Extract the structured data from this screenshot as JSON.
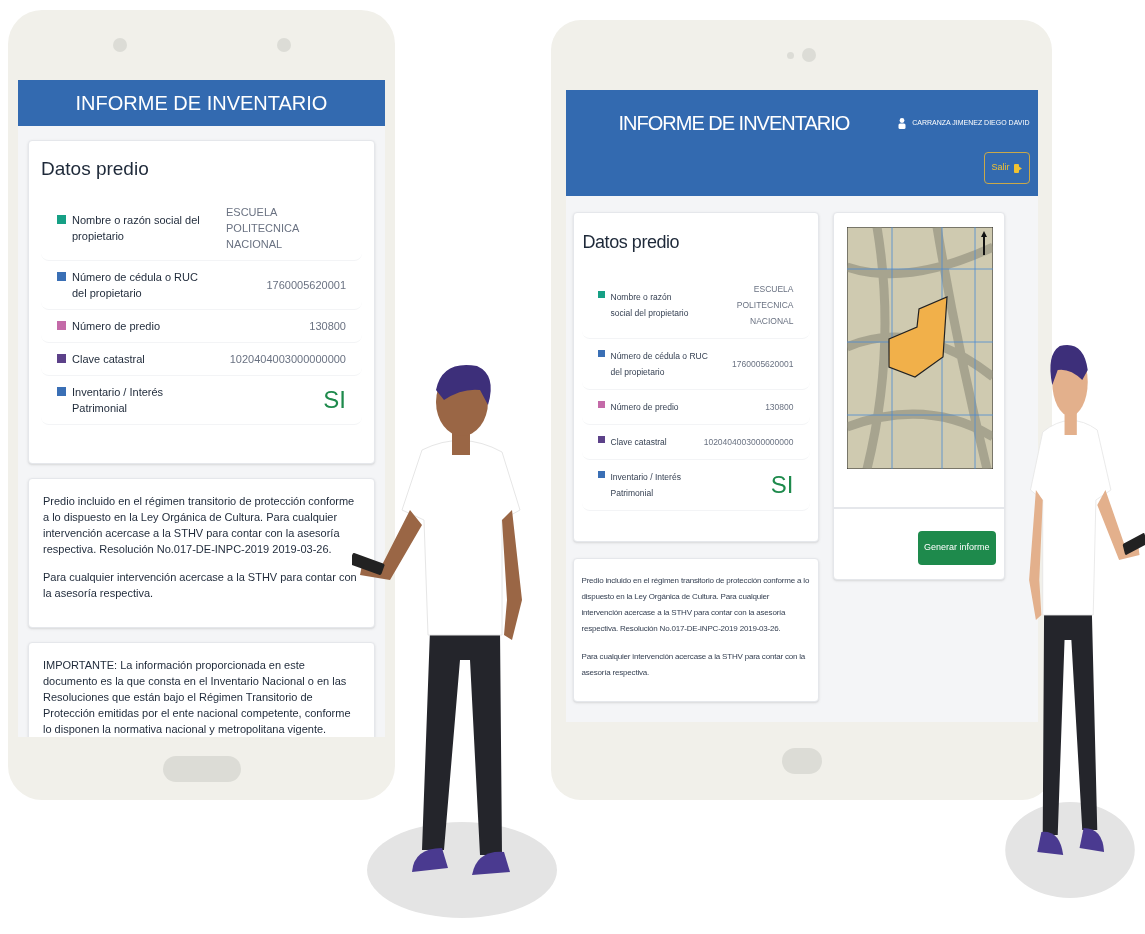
{
  "phone": {
    "header": {
      "title": "INFORME DE INVENTARIO"
    },
    "property_card": {
      "title": "Datos predio",
      "rows": [
        {
          "label": "Nombre o razón social del propietario",
          "value": "ESCUELA POLITECNICA NACIONAL",
          "color": "#16a085",
          "kind": "text"
        },
        {
          "label": "Número de cédula o RUC del propietario",
          "value": "1760005620001",
          "color": "#3a6fb5",
          "kind": "text"
        },
        {
          "label": "Número de predio",
          "value": "130800",
          "color": "#c46aa8",
          "kind": "text"
        },
        {
          "label": "Clave catastral",
          "value": "1020404003000000000",
          "color": "#5c4189",
          "kind": "text"
        },
        {
          "label": "Inventario / Interés Patrimonial",
          "value": "SI",
          "color": "#3a6fb5",
          "kind": "flag"
        }
      ]
    },
    "notice_card": {
      "paragraphs": [
        "Predio incluido en el régimen transitorio de protección conforme a lo dispuesto en la Ley Orgánica de Cultura. Para cualquier intervención acercase a la STHV para contar con la asesoría respectiva. Resolución No.017-DE-INPC-2019 2019-03-26.",
        "Para cualquier intervención acercase a la STHV para contar con la asesoría respectiva."
      ]
    },
    "important_card": {
      "text": "IMPORTANTE: La información proporcionada en este documento es la que consta en el Inventario Nacional o en las Resoluciones que están bajo el Régimen Transitorio de Protección emitidas por el ente nacional competente, conforme lo disponen la normativa nacional y metropolitana vigente."
    }
  },
  "tablet": {
    "header": {
      "title": "INFORME DE INVENTARIO",
      "user": "CARRANZA JIMENEZ DIEGO DAVID",
      "logout_button": "Salir"
    },
    "property_card": {
      "title": "Datos predio",
      "rows": [
        {
          "label": "Nombre o razón social del propietario",
          "value": "ESCUELA POLITECNICA NACIONAL",
          "color": "#16a085",
          "kind": "text"
        },
        {
          "label": "Número de cédula o RUC del propietario",
          "value": "1760005620001",
          "color": "#3a6fb5",
          "kind": "text"
        },
        {
          "label": "Número de predio",
          "value": "130800",
          "color": "#c46aa8",
          "kind": "text"
        },
        {
          "label": "Clave catastral",
          "value": "1020404003000000000",
          "color": "#5c4189",
          "kind": "text"
        },
        {
          "label": "Inventario / Interés Patrimonial",
          "value": "SI",
          "color": "#3a6fb5",
          "kind": "flag"
        }
      ]
    },
    "map_card": {
      "button": "Generar informe"
    },
    "notice_card": {
      "paragraphs": [
        "Predio incluido en el régimen transitorio de protección conforme a lo dispuesto en la Ley Orgánica de Cultura. Para cualquier intervención acercase a la STHV para contar con la asesoría respectiva. Resolución No.017-DE-INPC-2019 2019-03-26.",
        "Para cualquier intervención acercase a la STHV para contar con la asesoría respectiva."
      ]
    }
  }
}
